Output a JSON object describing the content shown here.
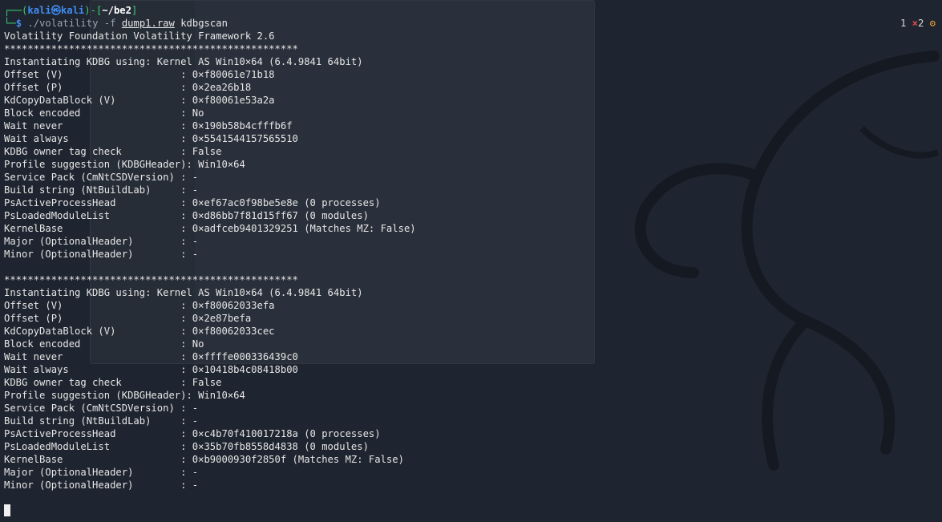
{
  "prompt": {
    "user": "kali",
    "at": "㉿",
    "host": "kali",
    "path": "~/be2",
    "command": "./volatility",
    "flag": "-f",
    "file": "dump1.raw",
    "plugin": "kdbgscan"
  },
  "status": {
    "count": "1",
    "x_icon": "×",
    "errors": "2",
    "gear_icon": "⚙"
  },
  "output": [
    "Volatility Foundation Volatility Framework 2.6",
    "**************************************************",
    "Instantiating KDBG using: Kernel AS Win10×64 (6.4.9841 64bit)",
    "Offset (V)                    : 0×f80061e71b18",
    "Offset (P)                    : 0×2ea26b18",
    "KdCopyDataBlock (V)           : 0×f80061e53a2a",
    "Block encoded                 : No",
    "Wait never                    : 0×190b58b4cfffb6f",
    "Wait always                   : 0×5541544157565510",
    "KDBG owner tag check          : False",
    "Profile suggestion (KDBGHeader): Win10×64",
    "Service Pack (CmNtCSDVersion) : -",
    "Build string (NtBuildLab)     : -",
    "PsActiveProcessHead           : 0×ef67ac0f98be5e8e (0 processes)",
    "PsLoadedModuleList            : 0×d86bb7f81d15ff67 (0 modules)",
    "KernelBase                    : 0×adfceb9401329251 (Matches MZ: False)",
    "Major (OptionalHeader)        : -",
    "Minor (OptionalHeader)        : -",
    "",
    "**************************************************",
    "Instantiating KDBG using: Kernel AS Win10×64 (6.4.9841 64bit)",
    "Offset (V)                    : 0×f80062033efa",
    "Offset (P)                    : 0×2e87befa",
    "KdCopyDataBlock (V)           : 0×f80062033cec",
    "Block encoded                 : No",
    "Wait never                    : 0×ffffe000336439c0",
    "Wait always                   : 0×10418b4c08418b00",
    "KDBG owner tag check          : False",
    "Profile suggestion (KDBGHeader): Win10×64",
    "Service Pack (CmNtCSDVersion) : -",
    "Build string (NtBuildLab)     : -",
    "PsActiveProcessHead           : 0×c4b70f410017218a (0 processes)",
    "PsLoadedModuleList            : 0×35b70fb8558d4838 (0 modules)",
    "KernelBase                    : 0×b9000930f2850f (Matches MZ: False)",
    "Major (OptionalHeader)        : -",
    "Minor (OptionalHeader)        : -"
  ]
}
